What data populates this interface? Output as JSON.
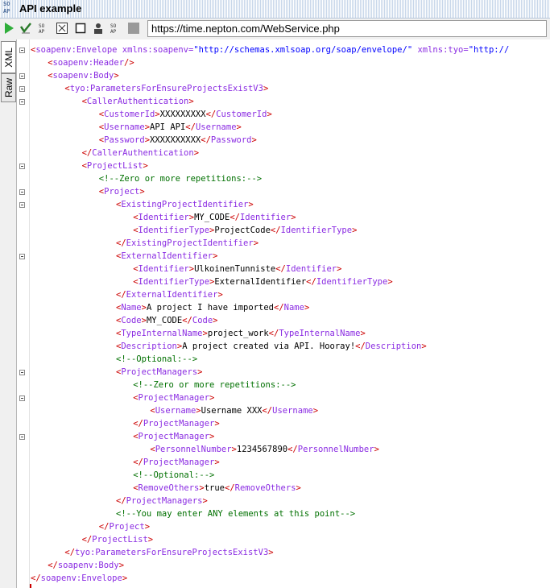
{
  "window": {
    "title": "API example",
    "soap_logo": "SOAP"
  },
  "toolbar": {
    "icons": [
      "run-icon",
      "validate-icon",
      "soap-envelope-icon",
      "layout-icon",
      "stop-icon",
      "auth-icon",
      "soap-settings-icon",
      "gray-block-icon"
    ],
    "url": "https://time.nepton.com/WebService.php"
  },
  "side_tabs": {
    "xml": "XML",
    "raw": "Raw"
  },
  "code_lines": [
    {
      "ind": 0,
      "fold": true,
      "segs": [
        [
          "b",
          "<"
        ],
        [
          "t",
          "soapenv:Envelope "
        ],
        [
          "a",
          "xmlns:soapenv="
        ],
        [
          "v",
          "\"http://schemas.xmlsoap.org/soap/envelope/\""
        ],
        [
          "a",
          " xmlns:tyo="
        ],
        [
          "v",
          "\"http://"
        ]
      ]
    },
    {
      "ind": 1,
      "fold": false,
      "segs": [
        [
          "b",
          "<"
        ],
        [
          "t",
          "soapenv:Header"
        ],
        [
          "b",
          "/>"
        ]
      ]
    },
    {
      "ind": 1,
      "fold": true,
      "segs": [
        [
          "b",
          "<"
        ],
        [
          "t",
          "soapenv:Body"
        ],
        [
          "b",
          ">"
        ]
      ]
    },
    {
      "ind": 2,
      "fold": true,
      "segs": [
        [
          "b",
          "<"
        ],
        [
          "t",
          "tyo:ParametersForEnsureProjectsExistV3"
        ],
        [
          "b",
          ">"
        ]
      ]
    },
    {
      "ind": 3,
      "fold": true,
      "segs": [
        [
          "b",
          "<"
        ],
        [
          "t",
          "CallerAuthentication"
        ],
        [
          "b",
          ">"
        ]
      ]
    },
    {
      "ind": 4,
      "fold": false,
      "segs": [
        [
          "b",
          "<"
        ],
        [
          "t",
          "CustomerId"
        ],
        [
          "b",
          ">"
        ],
        [
          "tx",
          "XXXXXXXXX"
        ],
        [
          "b",
          "</"
        ],
        [
          "t",
          "CustomerId"
        ],
        [
          "b",
          ">"
        ]
      ]
    },
    {
      "ind": 4,
      "fold": false,
      "segs": [
        [
          "b",
          "<"
        ],
        [
          "t",
          "Username"
        ],
        [
          "b",
          ">"
        ],
        [
          "tx",
          "API API"
        ],
        [
          "b",
          "</"
        ],
        [
          "t",
          "Username"
        ],
        [
          "b",
          ">"
        ]
      ]
    },
    {
      "ind": 4,
      "fold": false,
      "segs": [
        [
          "b",
          "<"
        ],
        [
          "t",
          "Password"
        ],
        [
          "b",
          ">"
        ],
        [
          "tx",
          "XXXXXXXXXX"
        ],
        [
          "b",
          "</"
        ],
        [
          "t",
          "Password"
        ],
        [
          "b",
          ">"
        ]
      ]
    },
    {
      "ind": 3,
      "fold": false,
      "segs": [
        [
          "b",
          "</"
        ],
        [
          "t",
          "CallerAuthentication"
        ],
        [
          "b",
          ">"
        ]
      ]
    },
    {
      "ind": 3,
      "fold": true,
      "segs": [
        [
          "b",
          "<"
        ],
        [
          "t",
          "ProjectList"
        ],
        [
          "b",
          ">"
        ]
      ]
    },
    {
      "ind": 4,
      "fold": false,
      "segs": [
        [
          "c",
          "<!--Zero or more repetitions:-->"
        ]
      ]
    },
    {
      "ind": 4,
      "fold": true,
      "segs": [
        [
          "b",
          "<"
        ],
        [
          "t",
          "Project"
        ],
        [
          "b",
          ">"
        ]
      ]
    },
    {
      "ind": 5,
      "fold": true,
      "segs": [
        [
          "b",
          "<"
        ],
        [
          "t",
          "ExistingProjectIdentifier"
        ],
        [
          "b",
          ">"
        ]
      ]
    },
    {
      "ind": 6,
      "fold": false,
      "segs": [
        [
          "b",
          "<"
        ],
        [
          "t",
          "Identifier"
        ],
        [
          "b",
          ">"
        ],
        [
          "tx",
          "MY_CODE"
        ],
        [
          "b",
          "</"
        ],
        [
          "t",
          "Identifier"
        ],
        [
          "b",
          ">"
        ]
      ]
    },
    {
      "ind": 6,
      "fold": false,
      "segs": [
        [
          "b",
          "<"
        ],
        [
          "t",
          "IdentifierType"
        ],
        [
          "b",
          ">"
        ],
        [
          "tx",
          "ProjectCode"
        ],
        [
          "b",
          "</"
        ],
        [
          "t",
          "IdentifierType"
        ],
        [
          "b",
          ">"
        ]
      ]
    },
    {
      "ind": 5,
      "fold": false,
      "segs": [
        [
          "b",
          "</"
        ],
        [
          "t",
          "ExistingProjectIdentifier"
        ],
        [
          "b",
          ">"
        ]
      ]
    },
    {
      "ind": 5,
      "fold": true,
      "segs": [
        [
          "b",
          "<"
        ],
        [
          "t",
          "ExternalIdentifier"
        ],
        [
          "b",
          ">"
        ]
      ]
    },
    {
      "ind": 6,
      "fold": false,
      "segs": [
        [
          "b",
          "<"
        ],
        [
          "t",
          "Identifier"
        ],
        [
          "b",
          ">"
        ],
        [
          "tx",
          "UlkoinenTunniste"
        ],
        [
          "b",
          "</"
        ],
        [
          "t",
          "Identifier"
        ],
        [
          "b",
          ">"
        ]
      ]
    },
    {
      "ind": 6,
      "fold": false,
      "segs": [
        [
          "b",
          "<"
        ],
        [
          "t",
          "IdentifierType"
        ],
        [
          "b",
          ">"
        ],
        [
          "tx",
          "ExternalIdentifier"
        ],
        [
          "b",
          "</"
        ],
        [
          "t",
          "IdentifierType"
        ],
        [
          "b",
          ">"
        ]
      ]
    },
    {
      "ind": 5,
      "fold": false,
      "segs": [
        [
          "b",
          "</"
        ],
        [
          "t",
          "ExternalIdentifier"
        ],
        [
          "b",
          ">"
        ]
      ]
    },
    {
      "ind": 5,
      "fold": false,
      "segs": [
        [
          "b",
          "<"
        ],
        [
          "t",
          "Name"
        ],
        [
          "b",
          ">"
        ],
        [
          "tx",
          "A project I have imported"
        ],
        [
          "b",
          "</"
        ],
        [
          "t",
          "Name"
        ],
        [
          "b",
          ">"
        ]
      ]
    },
    {
      "ind": 5,
      "fold": false,
      "segs": [
        [
          "b",
          "<"
        ],
        [
          "t",
          "Code"
        ],
        [
          "b",
          ">"
        ],
        [
          "tx",
          "MY_CODE"
        ],
        [
          "b",
          "</"
        ],
        [
          "t",
          "Code"
        ],
        [
          "b",
          ">"
        ]
      ]
    },
    {
      "ind": 5,
      "fold": false,
      "segs": [
        [
          "b",
          "<"
        ],
        [
          "t",
          "TypeInternalName"
        ],
        [
          "b",
          ">"
        ],
        [
          "tx",
          "project_work"
        ],
        [
          "b",
          "</"
        ],
        [
          "t",
          "TypeInternalName"
        ],
        [
          "b",
          ">"
        ]
      ]
    },
    {
      "ind": 5,
      "fold": false,
      "segs": [
        [
          "b",
          "<"
        ],
        [
          "t",
          "Description"
        ],
        [
          "b",
          ">"
        ],
        [
          "tx",
          "A project created via API. Hooray!"
        ],
        [
          "b",
          "</"
        ],
        [
          "t",
          "Description"
        ],
        [
          "b",
          ">"
        ]
      ]
    },
    {
      "ind": 5,
      "fold": false,
      "segs": [
        [
          "c",
          "<!--Optional:-->"
        ]
      ]
    },
    {
      "ind": 5,
      "fold": true,
      "segs": [
        [
          "b",
          "<"
        ],
        [
          "t",
          "ProjectManagers"
        ],
        [
          "b",
          ">"
        ]
      ]
    },
    {
      "ind": 6,
      "fold": false,
      "segs": [
        [
          "c",
          "<!--Zero or more repetitions:-->"
        ]
      ]
    },
    {
      "ind": 6,
      "fold": true,
      "segs": [
        [
          "b",
          "<"
        ],
        [
          "t",
          "ProjectManager"
        ],
        [
          "b",
          ">"
        ]
      ]
    },
    {
      "ind": 7,
      "fold": false,
      "segs": [
        [
          "b",
          "<"
        ],
        [
          "t",
          "Username"
        ],
        [
          "b",
          ">"
        ],
        [
          "tx",
          "Username XXX"
        ],
        [
          "b",
          "</"
        ],
        [
          "t",
          "Username"
        ],
        [
          "b",
          ">"
        ]
      ]
    },
    {
      "ind": 6,
      "fold": false,
      "segs": [
        [
          "b",
          "</"
        ],
        [
          "t",
          "ProjectManager"
        ],
        [
          "b",
          ">"
        ]
      ]
    },
    {
      "ind": 6,
      "fold": true,
      "segs": [
        [
          "b",
          "<"
        ],
        [
          "t",
          "ProjectManager"
        ],
        [
          "b",
          ">"
        ]
      ]
    },
    {
      "ind": 7,
      "fold": false,
      "segs": [
        [
          "b",
          "<"
        ],
        [
          "t",
          "PersonnelNumber"
        ],
        [
          "b",
          ">"
        ],
        [
          "tx",
          "1234567890"
        ],
        [
          "b",
          "</"
        ],
        [
          "t",
          "PersonnelNumber"
        ],
        [
          "b",
          ">"
        ]
      ]
    },
    {
      "ind": 6,
      "fold": false,
      "segs": [
        [
          "b",
          "</"
        ],
        [
          "t",
          "ProjectManager"
        ],
        [
          "b",
          ">"
        ]
      ]
    },
    {
      "ind": 6,
      "fold": false,
      "segs": [
        [
          "c",
          "<!--Optional:-->"
        ]
      ]
    },
    {
      "ind": 6,
      "fold": false,
      "segs": [
        [
          "b",
          "<"
        ],
        [
          "t",
          "RemoveOthers"
        ],
        [
          "b",
          ">"
        ],
        [
          "tx",
          "true"
        ],
        [
          "b",
          "</"
        ],
        [
          "t",
          "RemoveOthers"
        ],
        [
          "b",
          ">"
        ]
      ]
    },
    {
      "ind": 5,
      "fold": false,
      "segs": [
        [
          "b",
          "</"
        ],
        [
          "t",
          "ProjectManagers"
        ],
        [
          "b",
          ">"
        ]
      ]
    },
    {
      "ind": 5,
      "fold": false,
      "segs": [
        [
          "c",
          "<!--You may enter ANY elements at this point-->"
        ]
      ]
    },
    {
      "ind": 4,
      "fold": false,
      "segs": [
        [
          "b",
          "</"
        ],
        [
          "t",
          "Project"
        ],
        [
          "b",
          ">"
        ]
      ]
    },
    {
      "ind": 3,
      "fold": false,
      "segs": [
        [
          "b",
          "</"
        ],
        [
          "t",
          "ProjectList"
        ],
        [
          "b",
          ">"
        ]
      ]
    },
    {
      "ind": 2,
      "fold": false,
      "segs": [
        [
          "b",
          "</"
        ],
        [
          "t",
          "tyo:ParametersForEnsureProjectsExistV3"
        ],
        [
          "b",
          ">"
        ]
      ]
    },
    {
      "ind": 1,
      "fold": false,
      "segs": [
        [
          "b",
          "</"
        ],
        [
          "t",
          "soapenv:Body"
        ],
        [
          "b",
          ">"
        ]
      ]
    },
    {
      "ind": 0,
      "fold": false,
      "segs": [
        [
          "b",
          "</"
        ],
        [
          "t",
          "soapenv:Envelope"
        ],
        [
          "b",
          ">"
        ]
      ]
    }
  ]
}
